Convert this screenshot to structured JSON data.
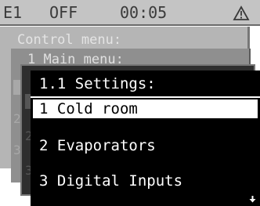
{
  "status": {
    "unit": "E1",
    "state": "OFF",
    "time": "00:05",
    "alarm_icon": "warning-triangle-icon"
  },
  "layers": {
    "control_menu": "Control menu:",
    "main_menu": "1 Main menu:"
  },
  "settings": {
    "title": "1.1 Settings:",
    "items": [
      {
        "label": "1 Cold room",
        "selected": true
      },
      {
        "label": "2 Evaporators",
        "selected": false
      },
      {
        "label": "3 Digital Inputs",
        "selected": false
      }
    ]
  },
  "colors": {
    "screen_bg": "#000000",
    "text": "#ffffff",
    "highlight_bg": "#ffffff",
    "status_bar": "#c4c4c4"
  }
}
